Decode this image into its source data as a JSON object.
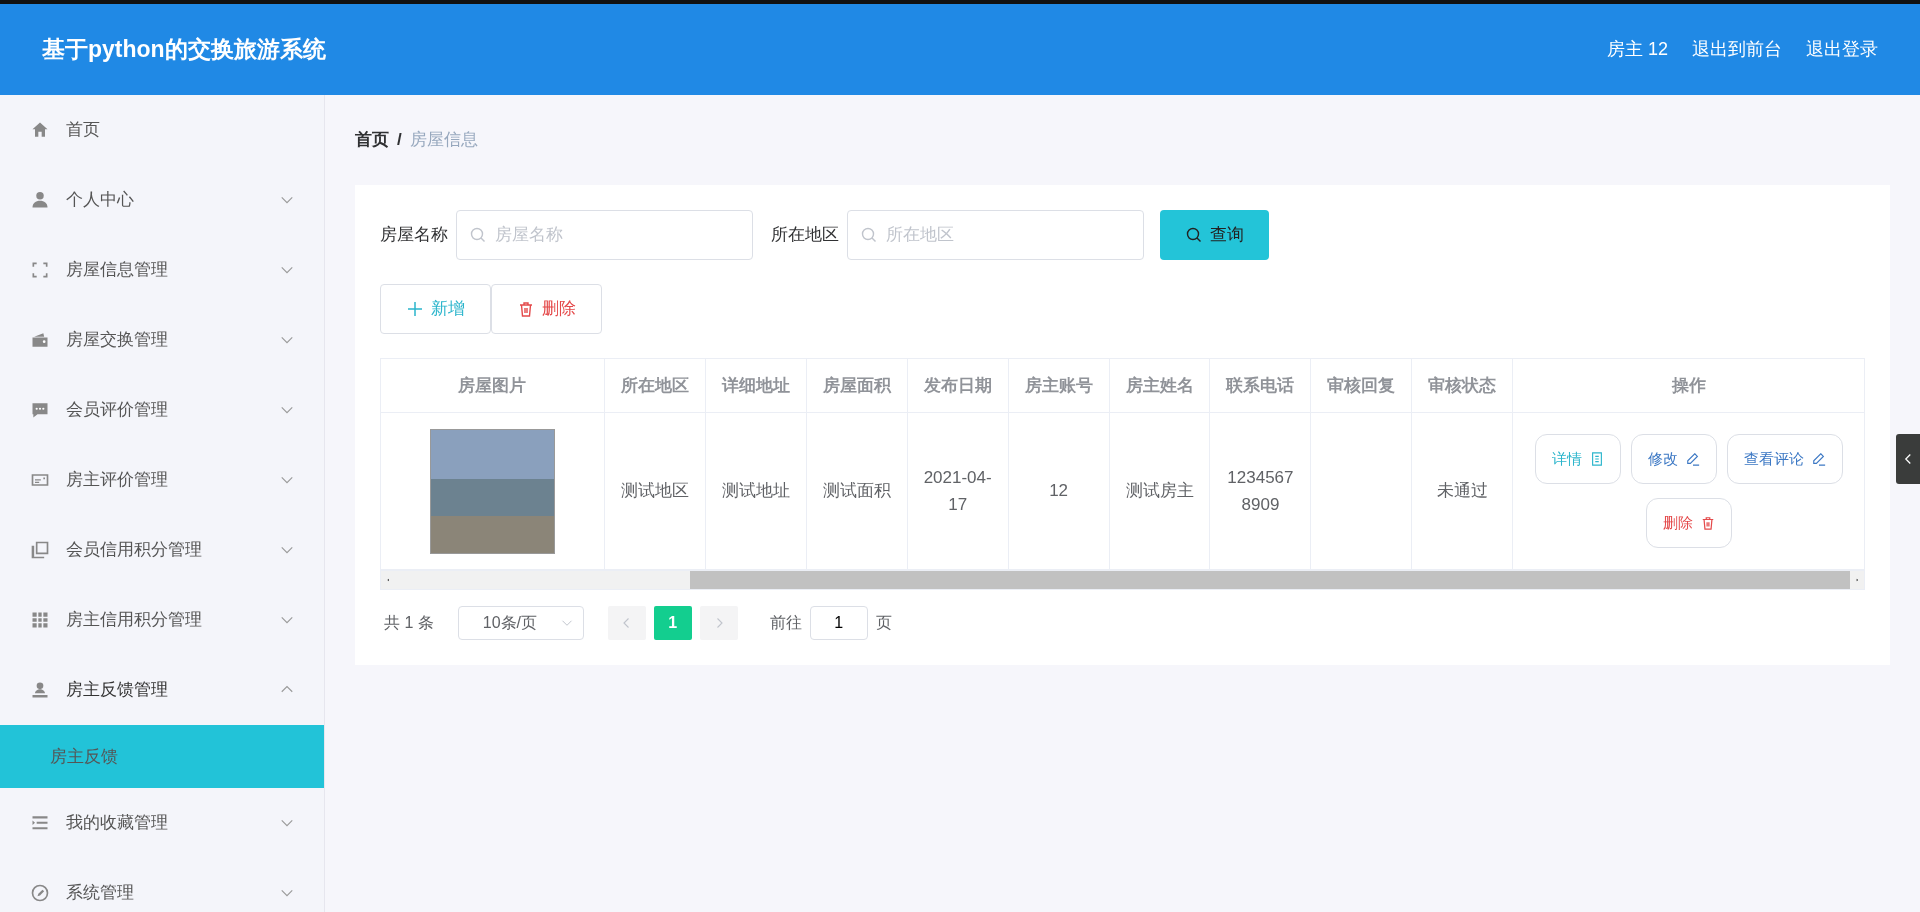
{
  "header": {
    "title": "基于python的交换旅游系统",
    "links": [
      "房主 12",
      "退出到前台",
      "退出登录"
    ]
  },
  "sidebar": {
    "items": [
      {
        "label": "首页",
        "kind": "link"
      },
      {
        "label": "个人中心",
        "kind": "menu",
        "expanded": false
      },
      {
        "label": "房屋信息管理",
        "kind": "menu",
        "expanded": false
      },
      {
        "label": "房屋交换管理",
        "kind": "menu",
        "expanded": false
      },
      {
        "label": "会员评价管理",
        "kind": "menu",
        "expanded": false
      },
      {
        "label": "房主评价管理",
        "kind": "menu",
        "expanded": false
      },
      {
        "label": "会员信用积分管理",
        "kind": "menu",
        "expanded": false
      },
      {
        "label": "房主信用积分管理",
        "kind": "menu",
        "expanded": false
      },
      {
        "label": "房主反馈管理",
        "kind": "menu",
        "expanded": true,
        "children": [
          {
            "label": "房主反馈",
            "selected": true
          }
        ]
      },
      {
        "label": "我的收藏管理",
        "kind": "menu",
        "expanded": false
      },
      {
        "label": "系统管理",
        "kind": "menu",
        "expanded": false
      }
    ]
  },
  "breadcrumb": [
    "首页",
    "/",
    "房屋信息"
  ],
  "search": {
    "fields": [
      {
        "label": "房屋名称",
        "placeholder": "房屋名称"
      },
      {
        "label": "所在地区",
        "placeholder": "所在地区"
      }
    ],
    "button": "查询"
  },
  "actions": [
    {
      "label": "新增",
      "kind": "add"
    },
    {
      "label": "删除",
      "kind": "delete"
    }
  ],
  "table": {
    "columns": [
      "房屋图片",
      "所在地区",
      "详细地址",
      "房屋面积",
      "发布日期",
      "房主账号",
      "房主姓名",
      "联系电话",
      "审核回复",
      "审核状态",
      "操作"
    ],
    "rows": [
      {
        "cells": [
          "",
          "测试地区",
          "测试地址",
          "测试面积",
          "2021-04-17",
          "12",
          "测试房主",
          "12345678909",
          "",
          "未通过"
        ],
        "buttons": [
          {
            "label": "详情",
            "kind": "detail"
          },
          {
            "label": "修改",
            "kind": "edit"
          },
          {
            "label": "查看评论",
            "kind": "edit"
          },
          {
            "label": "删除",
            "kind": "delete"
          }
        ]
      }
    ]
  },
  "pagination": {
    "total": "共 1 条",
    "page_size": "10条/页",
    "pages": [
      {
        "label": "1",
        "selected": true
      }
    ],
    "goto_label": "前往",
    "goto_value": "1",
    "goto_suffix": "页"
  }
}
